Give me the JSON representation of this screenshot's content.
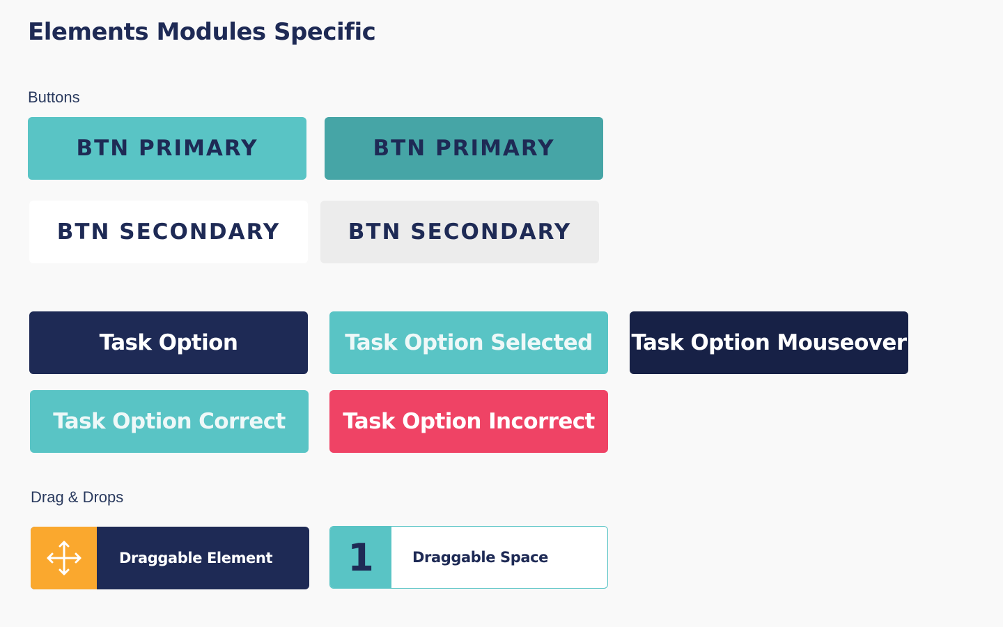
{
  "page": {
    "title": "Elements Modules Specific"
  },
  "sections": {
    "buttons_label": "Buttons",
    "drag_drops_label": "Drag & Drops"
  },
  "buttons": {
    "primary_label": "BTN PRIMARY",
    "primary_hover_label": "BTN PRIMARY",
    "secondary_label": "BTN SECONDARY",
    "secondary_hover_label": "BTN SECONDARY"
  },
  "task_options": {
    "default_label": "Task Option",
    "selected_label": "Task Option Selected",
    "mouseover_label": "Task Option Mouseover",
    "correct_label": "Task Option Correct",
    "incorrect_label": "Task Option Incorrect"
  },
  "drag_drop": {
    "draggable_label": "Draggable Element",
    "draggable_icon": "move-arrows-icon",
    "space_number": "1",
    "space_label": "Draggable Space"
  },
  "colors": {
    "navy": "#1e2a55",
    "navy_dark": "#172146",
    "teal": "#59c4c5",
    "teal_dark": "#46a5a6",
    "light_gray": "#ececec",
    "red": "#ef4365",
    "orange": "#faa82e",
    "background": "#f9f9f9"
  }
}
